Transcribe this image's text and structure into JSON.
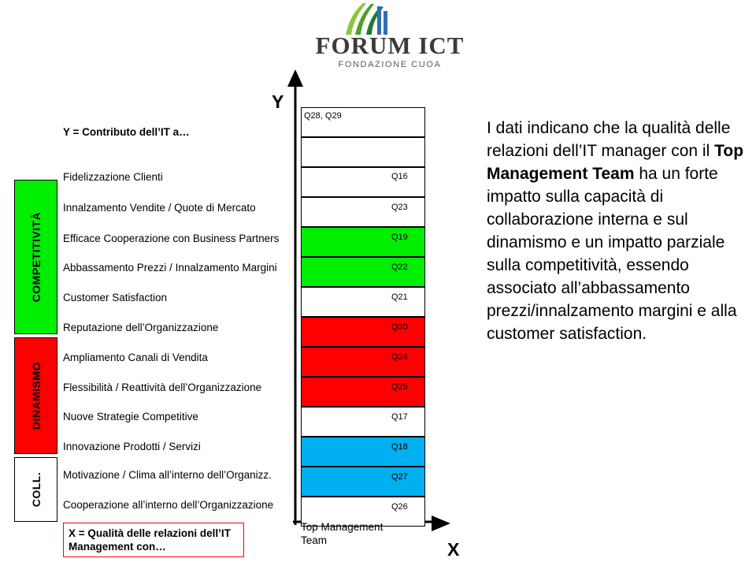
{
  "logo": {
    "title": "FORUM ICT",
    "subtitle": "FONDAZIONE CUOA",
    "mark": "leaf-mark-icon"
  },
  "axes": {
    "y_label": "Y",
    "x_label": "X",
    "y_legend": "Y = Contributo dell’IT a…",
    "x_legend": "X = Qualità delle relazioni dell’IT Management con…",
    "x_axis_value": "Top Management Team",
    "top_point_label": "Q28, Q29"
  },
  "groups": [
    {
      "label": "COMPETITIVITÀ",
      "color": "#00ee00"
    },
    {
      "label": "DINAMISMO",
      "color": "#ff0000"
    },
    {
      "label": "COLL.",
      "color": "#ffffff"
    }
  ],
  "rows": [
    {
      "label": "Fidelizzazione Clienti",
      "code": "Q16",
      "color": "#ffffff"
    },
    {
      "label": "Innalzamento Vendite / Quote di Mercato",
      "code": "Q23",
      "color": "#ffffff"
    },
    {
      "label": "Efficace Cooperazione con Business Partners",
      "code": "Q19",
      "color": "#ffffff"
    },
    {
      "label": "Abbassamento Prezzi / Innalzamento Margini",
      "code": "Q22",
      "color": "#00ee00"
    },
    {
      "label": "Customer Satisfaction",
      "code": "Q21",
      "color": "#00ee00"
    },
    {
      "label": "Reputazione dell’Organizzazione",
      "code": "Q20",
      "color": "#ffffff"
    },
    {
      "label": "Ampliamento Canali di Vendita",
      "code": "Q24",
      "color": "#ff0000"
    },
    {
      "label": "Flessibilità / Reattività dell’Organizzazione",
      "code": "Q25",
      "color": "#ff0000"
    },
    {
      "label": "Nuove Strategie Competitive",
      "code": "Q17",
      "color": "#ff0000"
    },
    {
      "label": "Innovazione Prodotti / Servizi",
      "code": "Q18",
      "color": "#ffffff"
    },
    {
      "label": "Motivazione / Clima all’interno dell’Organizz.",
      "code": "Q27",
      "color": "#00b0f0"
    },
    {
      "label": "Cooperazione all’interno dell’Organizzazione",
      "code": "Q26",
      "color": "#00b0f0"
    }
  ],
  "commentary": {
    "part1": "I dati indicano che la qualità delle relazioni dell’IT manager con il ",
    "bold": "Top Management Team",
    "part2": " ha un forte impatto sulla capacità di collaborazione interna e sul dinamismo e un impatto parziale sulla competitività, essendo associato all’abbassamento prezzi/innalzamento margini e alla customer satisfaction."
  }
}
